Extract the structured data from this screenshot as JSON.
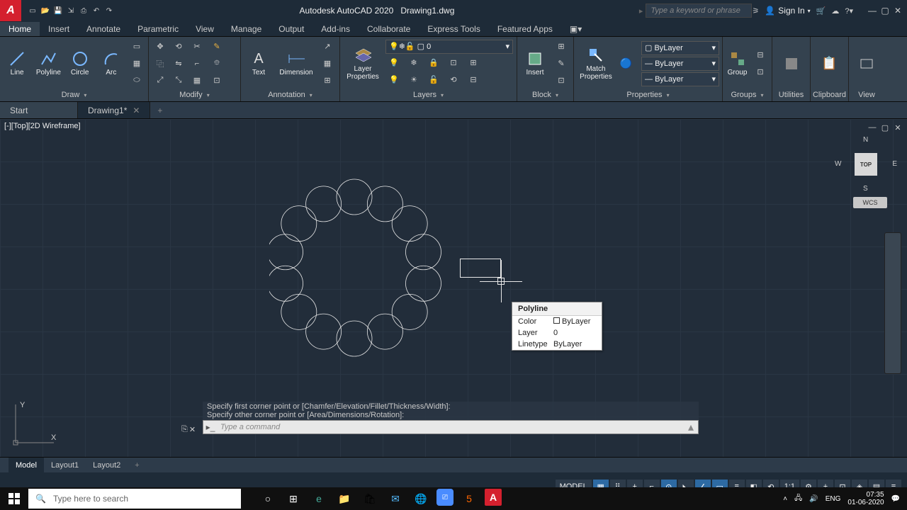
{
  "app": {
    "title": "Autodesk AutoCAD 2020",
    "filename": "Drawing1.dwg"
  },
  "search": {
    "placeholder": "Type a keyword or phrase"
  },
  "signin": {
    "label": "Sign In"
  },
  "menu": {
    "tabs": [
      "Home",
      "Insert",
      "Annotate",
      "Parametric",
      "View",
      "Manage",
      "Output",
      "Add-ins",
      "Collaborate",
      "Express Tools",
      "Featured Apps"
    ],
    "active": 0
  },
  "ribbon": {
    "draw": {
      "line": "Line",
      "polyline": "Polyline",
      "circle": "Circle",
      "arc": "Arc",
      "title": "Draw"
    },
    "modify": {
      "title": "Modify"
    },
    "annotation": {
      "text": "Text",
      "dimension": "Dimension",
      "title": "Annotation"
    },
    "layers": {
      "btn": "Layer\nProperties",
      "current": "0",
      "title": "Layers"
    },
    "block": {
      "insert": "Insert",
      "title": "Block"
    },
    "properties": {
      "match": "Match\nProperties",
      "color": "ByLayer",
      "lw": "ByLayer",
      "lt": "ByLayer",
      "title": "Properties"
    },
    "groups": {
      "group": "Group",
      "title": "Groups"
    },
    "utilities": {
      "label": "Utilities"
    },
    "clipboard": {
      "label": "Clipboard"
    },
    "view": {
      "label": "View"
    }
  },
  "doctabs": {
    "start": "Start",
    "items": [
      "Drawing1*"
    ],
    "active": 0
  },
  "viewport": {
    "label": "[-][Top][2D Wireframe]",
    "cube": "TOP",
    "wcs": "WCS",
    "compass": {
      "n": "N",
      "e": "E",
      "s": "S",
      "w": "W"
    }
  },
  "ucs": {
    "x": "X",
    "y": "Y"
  },
  "tooltip": {
    "title": "Polyline",
    "rows": [
      {
        "k": "Color",
        "v": "ByLayer"
      },
      {
        "k": "Layer",
        "v": "0"
      },
      {
        "k": "Linetype",
        "v": "ByLayer"
      }
    ]
  },
  "command": {
    "history": [
      "Specify first corner point or [Chamfer/Elevation/Fillet/Thickness/Width]:",
      "Specify other corner point or [Area/Dimensions/Rotation]:"
    ],
    "placeholder": "Type a command"
  },
  "layouts": {
    "tabs": [
      "Model",
      "Layout1",
      "Layout2"
    ],
    "active": 0
  },
  "status": {
    "model": "MODEL",
    "scale": "1:1"
  },
  "taskbar": {
    "search": "Type here to search",
    "lang": "ENG",
    "time": "07:35",
    "date": "01-06-2020"
  }
}
